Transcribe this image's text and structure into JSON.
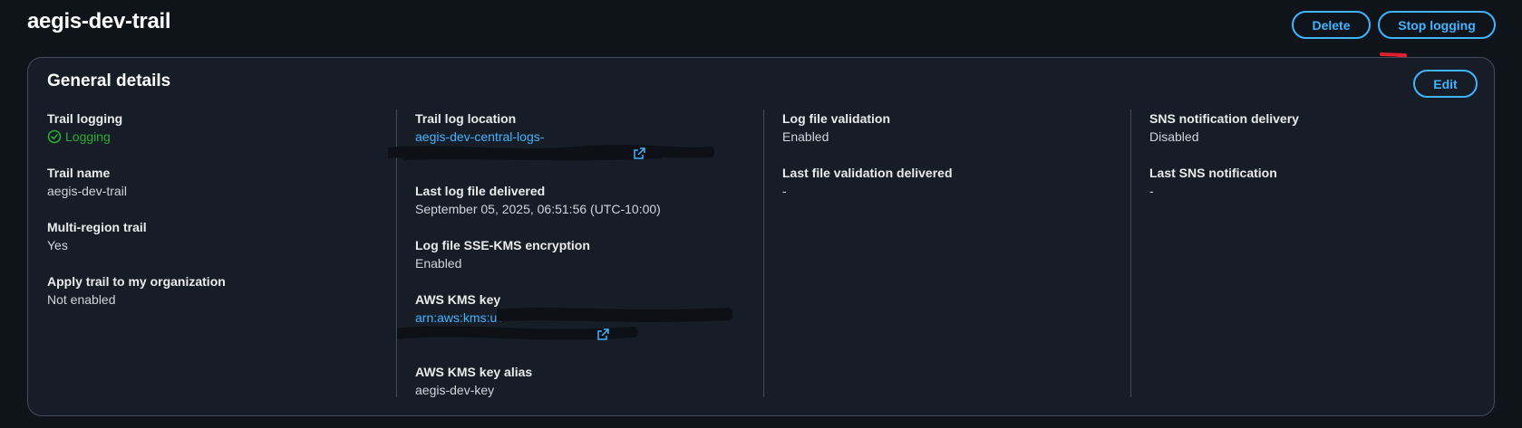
{
  "page": {
    "title": "aegis-dev-trail"
  },
  "actions": {
    "delete_label": "Delete",
    "stop_logging_label": "Stop logging",
    "edit_label": "Edit"
  },
  "general_details": {
    "title": "General details",
    "column1": {
      "trail_logging_label": "Trail logging",
      "trail_logging_value": "Logging",
      "trail_name_label": "Trail name",
      "trail_name_value": "aegis-dev-trail",
      "multi_region_label": "Multi-region trail",
      "multi_region_value": "Yes",
      "apply_org_label": "Apply trail to my organization",
      "apply_org_value": "Not enabled"
    },
    "column2": {
      "log_location_label": "Trail log location",
      "log_location_value": "aegis-dev-central-logs-",
      "last_delivered_label": "Last log file delivered",
      "last_delivered_value": "September 05, 2025, 06:51:56 (UTC-10:00)",
      "sse_kms_label": "Log file SSE-KMS encryption",
      "sse_kms_value": "Enabled",
      "kms_key_label": "AWS KMS key",
      "kms_key_value": "arn:aws:kms:us-",
      "kms_alias_label": "AWS KMS key alias",
      "kms_alias_value": "aegis-dev-key"
    },
    "column3": {
      "validation_label": "Log file validation",
      "validation_value": "Enabled",
      "last_validation_label": "Last file validation delivered",
      "last_validation_value": "-"
    },
    "column4": {
      "sns_label": "SNS notification delivery",
      "sns_value": "Disabled",
      "last_sns_label": "Last SNS notification",
      "last_sns_value": "-"
    }
  },
  "colors": {
    "background": "#0f141a",
    "card": "#161d26",
    "accent": "#42b4ff",
    "success": "#29ad32",
    "annotation_arrow": "#e0202e"
  },
  "icons": [
    "check-circle-icon",
    "external-link-icon",
    "annotation-arrow-icon"
  ]
}
